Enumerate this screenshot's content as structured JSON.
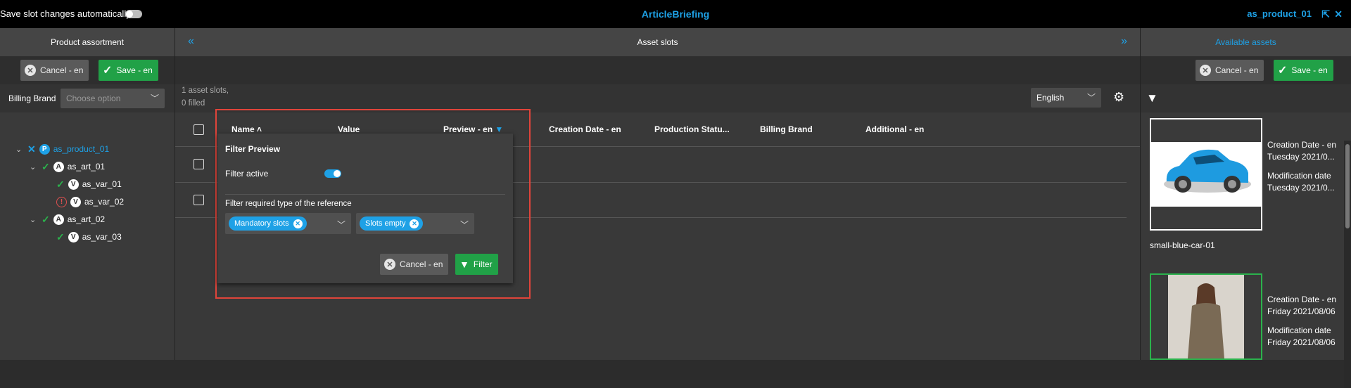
{
  "topbar": {
    "autosave_label": "Save slot changes automatically",
    "app_title": "ArticleBriefing",
    "product_name": "as_product_01"
  },
  "left": {
    "header": "Product assortment",
    "cancel_label": "Cancel - en",
    "save_label": "Save - en",
    "billing_label": "Billing Brand",
    "billing_placeholder": "Choose option",
    "tree": [
      {
        "label": "as_product_01",
        "type": "P"
      },
      {
        "label": "as_art_01",
        "type": "A"
      },
      {
        "label": "as_var_01",
        "type": "V"
      },
      {
        "label": "as_var_02",
        "type": "V"
      },
      {
        "label": "as_art_02",
        "type": "A"
      },
      {
        "label": "as_var_03",
        "type": "V"
      }
    ]
  },
  "center": {
    "header": "Asset slots",
    "count_line1": "1 asset slots,",
    "count_line2": "0 filled",
    "language": "English",
    "columns": [
      "Name",
      "Value",
      "Preview - en",
      "Creation Date - en",
      "Production Statu...",
      "Billing Brand",
      "Additional - en"
    ]
  },
  "popup": {
    "title": "Filter Preview",
    "active_label": "Filter active",
    "required_label": "Filter required type of the reference",
    "tag1": "Mandatory slots",
    "tag2": "Slots empty",
    "cancel_label": "Cancel - en",
    "filter_label": "Filter"
  },
  "right": {
    "header": "Available assets",
    "cancel_label": "Cancel - en",
    "save_label": "Save - en",
    "assets": [
      {
        "name": "small-blue-car-01",
        "created_label": "Creation Date - en",
        "created": "Tuesday 2021/0...",
        "modified_label": "Modification date",
        "modified": "Tuesday 2021/0..."
      },
      {
        "created_label": "Creation Date - en",
        "created": "Friday 2021/08/06",
        "modified_label": "Modification date",
        "modified": "Friday 2021/08/06"
      }
    ]
  },
  "colors": {
    "accent": "#1ea1e6",
    "green": "#21a147",
    "highlight": "#e0443a"
  }
}
